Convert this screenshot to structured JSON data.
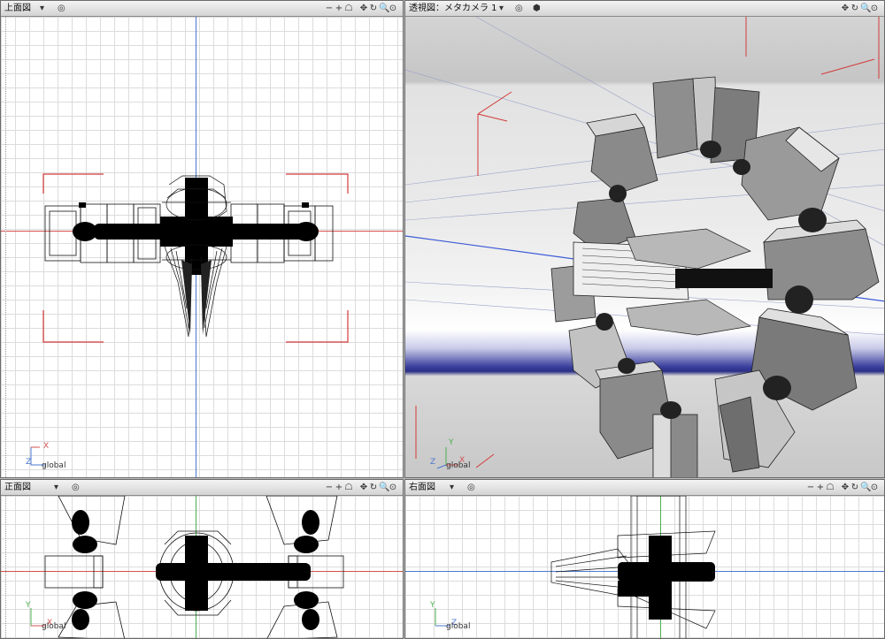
{
  "panes": {
    "top": {
      "title": "上面図",
      "axis_a": "X",
      "axis_b": "Z",
      "space": "global"
    },
    "perspective": {
      "title": "透視図：メタカメラ 1",
      "axis_a": "Y",
      "axis_b": "Z",
      "axis_c": "X",
      "space": "global"
    },
    "front": {
      "title": "正面図",
      "axis_a": "Y",
      "axis_b": "X",
      "space": "global"
    },
    "right": {
      "title": "右面図",
      "axis_a": "Y",
      "axis_b": "Z",
      "space": "global"
    }
  },
  "header_icons": {
    "dropdown": "▾",
    "view_target": "◎",
    "cube": "⬢",
    "zoom_out": "−",
    "zoom_in": "+",
    "camera": "☖",
    "move": "✥",
    "rotate": "↻",
    "zoom": "🔍",
    "fit": "⊙"
  },
  "colors": {
    "x_axis": "#d45050",
    "y_axis": "#4a78d0",
    "z_axis": "#4caf50",
    "frame_red": "#d43a3a"
  }
}
